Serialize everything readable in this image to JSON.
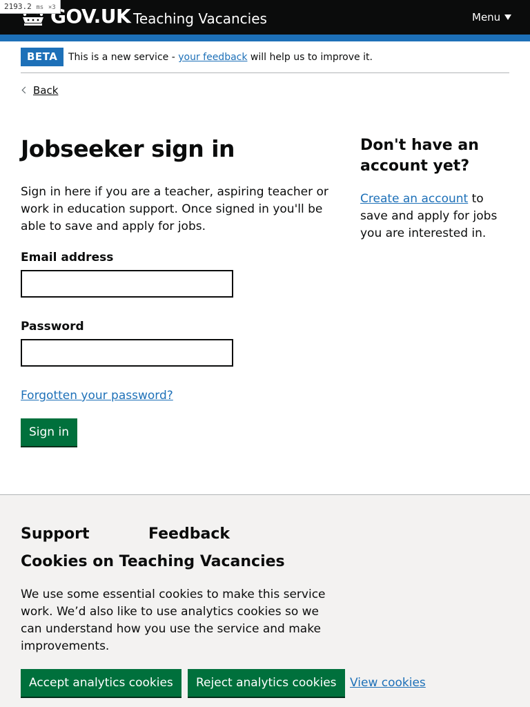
{
  "debug": {
    "timing": "2193.2",
    "unit": "ms",
    "multiplier": "×3"
  },
  "header": {
    "logo_text": "GOV.UK",
    "service_name": "Teaching Vacancies",
    "menu_label": "Menu",
    "icons": {
      "crown": "crown-icon",
      "menu_caret": "caret-down-icon"
    },
    "colors": {
      "background": "#0b0c0c",
      "stripe": "#1d70b8"
    }
  },
  "phase_banner": {
    "tag": "BETA",
    "text_before": "This is a new service - ",
    "link_text": "your feedback",
    "text_after": " will help us to improve it."
  },
  "back_link": {
    "label": "Back",
    "icon": "chevron-left-icon"
  },
  "main": {
    "title": "Jobseeker sign in",
    "intro": "Sign in here if you are a teacher, aspiring teacher or work in education support. Once signed in you'll be able to save and apply for jobs.",
    "email": {
      "label": "Email address",
      "value": "",
      "placeholder": ""
    },
    "password": {
      "label": "Password",
      "value": "",
      "placeholder": ""
    },
    "forgot_link": "Forgotten your password?",
    "submit_label": "Sign in"
  },
  "aside": {
    "title": "Don't have an account yet?",
    "link_text": "Create an account",
    "text_after": " to save and apply for jobs you are interested in."
  },
  "footer": {
    "headings": [
      "Support",
      "Feedback"
    ]
  },
  "cookie_banner": {
    "title": "Cookies on Teaching Vacancies",
    "text": "We use some essential cookies to make this service work. We’d also like to use analytics cookies so we can understand how you use the service and make improvements.",
    "accept_label": "Accept analytics cookies",
    "reject_label": "Reject analytics cookies",
    "view_label": "View cookies"
  },
  "colors": {
    "link": "#1d70b8",
    "button": "#00703c",
    "footer_bg": "#f3f2f1"
  }
}
